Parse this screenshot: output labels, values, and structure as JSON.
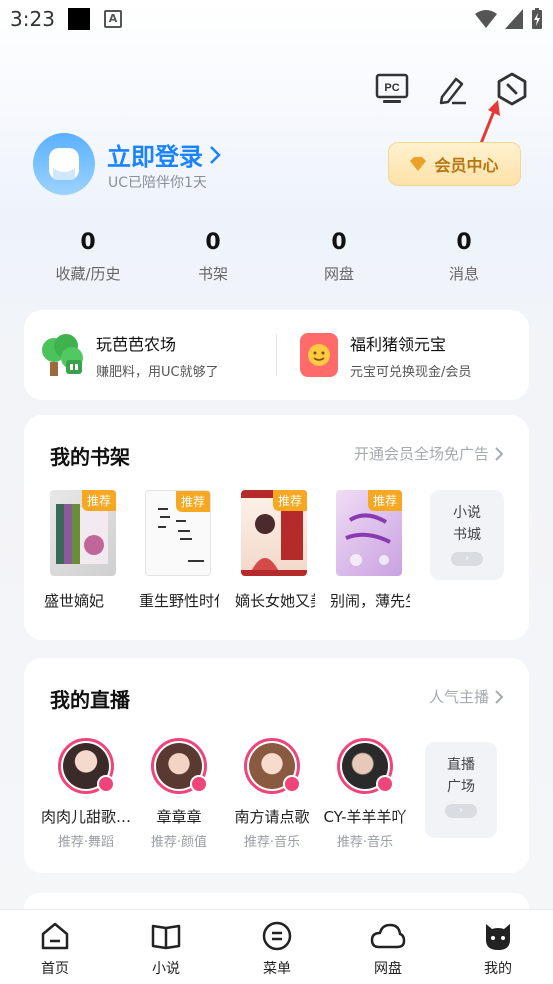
{
  "status": {
    "time": "3:23",
    "notif_glyph": "A"
  },
  "top_icons": [
    "pc-icon",
    "edit-icon",
    "settings-icon"
  ],
  "pc_label": "PC",
  "user": {
    "login_title": "立即登录",
    "subtitle": "UC已陪伴你1天",
    "vip_label": "会员中心"
  },
  "stats": [
    {
      "value": "0",
      "label": "收藏/历史"
    },
    {
      "value": "0",
      "label": "书架"
    },
    {
      "value": "0",
      "label": "网盘"
    },
    {
      "value": "0",
      "label": "消息"
    }
  ],
  "promos": [
    {
      "title": "玩芭芭农场",
      "subtitle": "赚肥料，用UC就够了",
      "icon": "farm-tree-icon"
    },
    {
      "title": "福利猪领元宝",
      "subtitle": "元宝可兑换现金/会员",
      "icon": "pig-icon"
    }
  ],
  "bookshelf": {
    "title": "我的书架",
    "link": "开通会员全场免广告",
    "tag": "推荐",
    "books": [
      {
        "title": "盛世嫡妃"
      },
      {
        "title": "重生野性时代"
      },
      {
        "title": "嫡长女她又美又飒"
      },
      {
        "title": "别闹，薄先生"
      }
    ],
    "more": {
      "line1": "小说",
      "line2": "书城"
    }
  },
  "live": {
    "title": "我的直播",
    "link": "人气主播",
    "anchors": [
      {
        "name": "肉肉儿甜歌…",
        "tag": "推荐·舞蹈"
      },
      {
        "name": "章章章",
        "tag": "推荐·颜值"
      },
      {
        "name": "南方请点歌",
        "tag": "推荐·音乐"
      },
      {
        "name": "CY-羊羊羊吖",
        "tag": "推荐·音乐"
      }
    ],
    "more": {
      "line1": "直播",
      "line2": "广场"
    }
  },
  "nav": [
    {
      "label": "首页",
      "icon": "home-icon"
    },
    {
      "label": "小说",
      "icon": "book-icon"
    },
    {
      "label": "菜单",
      "icon": "menu-icon"
    },
    {
      "label": "网盘",
      "icon": "cloud-icon"
    },
    {
      "label": "我的",
      "icon": "profile-icon"
    }
  ],
  "colors": {
    "accent": "#1a83ff",
    "vip": "#b57613",
    "live_ring": "#f0457a",
    "tag": "#f7a823"
  }
}
